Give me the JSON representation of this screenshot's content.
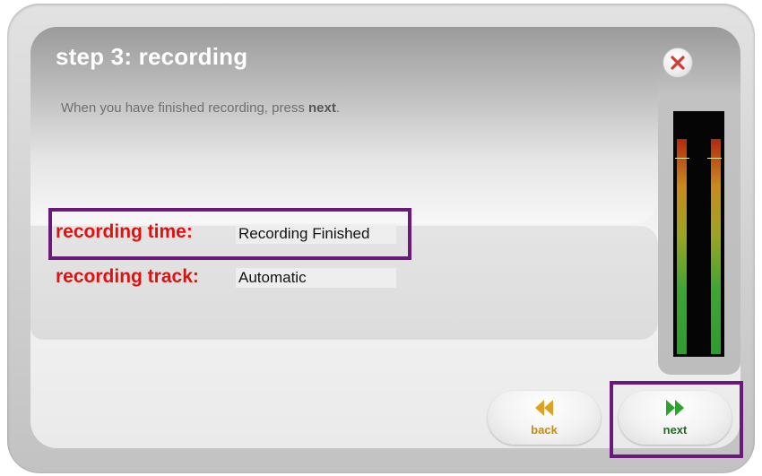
{
  "dialog": {
    "title": "step 3: recording",
    "instruction_prefix": "When you have finished recording, press ",
    "instruction_bold": "next",
    "instruction_suffix": "."
  },
  "fields": {
    "recording_time": {
      "label": "recording time:",
      "value": "Recording Finished"
    },
    "recording_track": {
      "label": "recording track:",
      "value": "Automatic"
    }
  },
  "buttons": {
    "back": {
      "label": "back",
      "icon": "double-chevron-left-icon",
      "color": "#e0a020"
    },
    "next": {
      "label": "next",
      "icon": "double-chevron-right-icon",
      "color": "#2aa52a"
    },
    "close": {
      "icon": "close-icon",
      "color": "#d63a2e"
    }
  },
  "colors": {
    "field_label": "#e31010",
    "highlight_border": "#6a1a7a"
  },
  "level_meter": {
    "channels": 2
  }
}
